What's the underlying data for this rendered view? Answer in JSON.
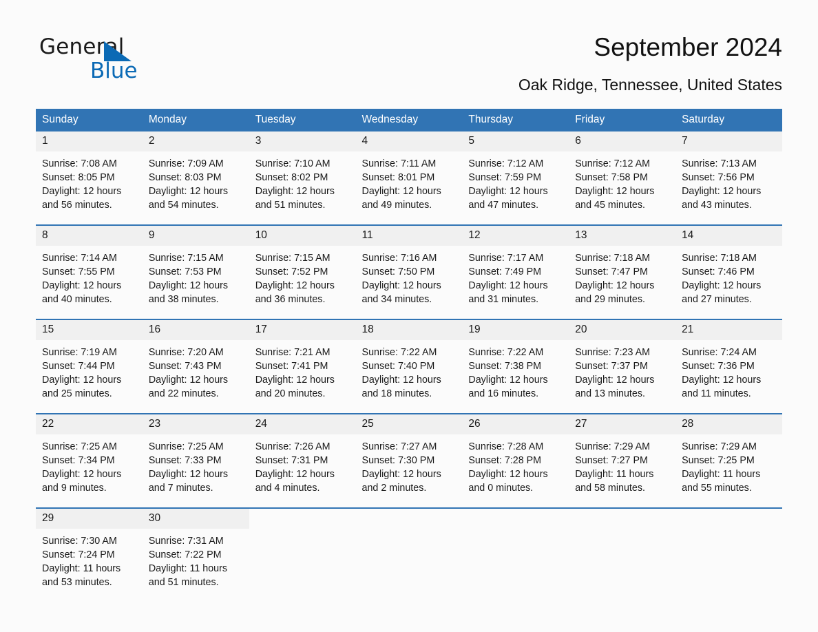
{
  "brand": {
    "name_part1": "General",
    "name_part2": "Blue",
    "triangle_color": "#0b6ab5"
  },
  "header": {
    "title": "September 2024",
    "location": "Oak Ridge, Tennessee, United States"
  },
  "theme": {
    "header_blue": "#3174b4",
    "date_band_gray": "#f0f0f0",
    "separator_blue": "#3174b4",
    "page_background": "#fbfbfb"
  },
  "weekdays": [
    "Sunday",
    "Monday",
    "Tuesday",
    "Wednesday",
    "Thursday",
    "Friday",
    "Saturday"
  ],
  "weeks": [
    [
      {
        "date": "1",
        "sunrise": "Sunrise: 7:08 AM",
        "sunset": "Sunset: 8:05 PM",
        "daylight_line1": "Daylight: 12 hours",
        "daylight_line2": "and 56 minutes."
      },
      {
        "date": "2",
        "sunrise": "Sunrise: 7:09 AM",
        "sunset": "Sunset: 8:03 PM",
        "daylight_line1": "Daylight: 12 hours",
        "daylight_line2": "and 54 minutes."
      },
      {
        "date": "3",
        "sunrise": "Sunrise: 7:10 AM",
        "sunset": "Sunset: 8:02 PM",
        "daylight_line1": "Daylight: 12 hours",
        "daylight_line2": "and 51 minutes."
      },
      {
        "date": "4",
        "sunrise": "Sunrise: 7:11 AM",
        "sunset": "Sunset: 8:01 PM",
        "daylight_line1": "Daylight: 12 hours",
        "daylight_line2": "and 49 minutes."
      },
      {
        "date": "5",
        "sunrise": "Sunrise: 7:12 AM",
        "sunset": "Sunset: 7:59 PM",
        "daylight_line1": "Daylight: 12 hours",
        "daylight_line2": "and 47 minutes."
      },
      {
        "date": "6",
        "sunrise": "Sunrise: 7:12 AM",
        "sunset": "Sunset: 7:58 PM",
        "daylight_line1": "Daylight: 12 hours",
        "daylight_line2": "and 45 minutes."
      },
      {
        "date": "7",
        "sunrise": "Sunrise: 7:13 AM",
        "sunset": "Sunset: 7:56 PM",
        "daylight_line1": "Daylight: 12 hours",
        "daylight_line2": "and 43 minutes."
      }
    ],
    [
      {
        "date": "8",
        "sunrise": "Sunrise: 7:14 AM",
        "sunset": "Sunset: 7:55 PM",
        "daylight_line1": "Daylight: 12 hours",
        "daylight_line2": "and 40 minutes."
      },
      {
        "date": "9",
        "sunrise": "Sunrise: 7:15 AM",
        "sunset": "Sunset: 7:53 PM",
        "daylight_line1": "Daylight: 12 hours",
        "daylight_line2": "and 38 minutes."
      },
      {
        "date": "10",
        "sunrise": "Sunrise: 7:15 AM",
        "sunset": "Sunset: 7:52 PM",
        "daylight_line1": "Daylight: 12 hours",
        "daylight_line2": "and 36 minutes."
      },
      {
        "date": "11",
        "sunrise": "Sunrise: 7:16 AM",
        "sunset": "Sunset: 7:50 PM",
        "daylight_line1": "Daylight: 12 hours",
        "daylight_line2": "and 34 minutes."
      },
      {
        "date": "12",
        "sunrise": "Sunrise: 7:17 AM",
        "sunset": "Sunset: 7:49 PM",
        "daylight_line1": "Daylight: 12 hours",
        "daylight_line2": "and 31 minutes."
      },
      {
        "date": "13",
        "sunrise": "Sunrise: 7:18 AM",
        "sunset": "Sunset: 7:47 PM",
        "daylight_line1": "Daylight: 12 hours",
        "daylight_line2": "and 29 minutes."
      },
      {
        "date": "14",
        "sunrise": "Sunrise: 7:18 AM",
        "sunset": "Sunset: 7:46 PM",
        "daylight_line1": "Daylight: 12 hours",
        "daylight_line2": "and 27 minutes."
      }
    ],
    [
      {
        "date": "15",
        "sunrise": "Sunrise: 7:19 AM",
        "sunset": "Sunset: 7:44 PM",
        "daylight_line1": "Daylight: 12 hours",
        "daylight_line2": "and 25 minutes."
      },
      {
        "date": "16",
        "sunrise": "Sunrise: 7:20 AM",
        "sunset": "Sunset: 7:43 PM",
        "daylight_line1": "Daylight: 12 hours",
        "daylight_line2": "and 22 minutes."
      },
      {
        "date": "17",
        "sunrise": "Sunrise: 7:21 AM",
        "sunset": "Sunset: 7:41 PM",
        "daylight_line1": "Daylight: 12 hours",
        "daylight_line2": "and 20 minutes."
      },
      {
        "date": "18",
        "sunrise": "Sunrise: 7:22 AM",
        "sunset": "Sunset: 7:40 PM",
        "daylight_line1": "Daylight: 12 hours",
        "daylight_line2": "and 18 minutes."
      },
      {
        "date": "19",
        "sunrise": "Sunrise: 7:22 AM",
        "sunset": "Sunset: 7:38 PM",
        "daylight_line1": "Daylight: 12 hours",
        "daylight_line2": "and 16 minutes."
      },
      {
        "date": "20",
        "sunrise": "Sunrise: 7:23 AM",
        "sunset": "Sunset: 7:37 PM",
        "daylight_line1": "Daylight: 12 hours",
        "daylight_line2": "and 13 minutes."
      },
      {
        "date": "21",
        "sunrise": "Sunrise: 7:24 AM",
        "sunset": "Sunset: 7:36 PM",
        "daylight_line1": "Daylight: 12 hours",
        "daylight_line2": "and 11 minutes."
      }
    ],
    [
      {
        "date": "22",
        "sunrise": "Sunrise: 7:25 AM",
        "sunset": "Sunset: 7:34 PM",
        "daylight_line1": "Daylight: 12 hours",
        "daylight_line2": "and 9 minutes."
      },
      {
        "date": "23",
        "sunrise": "Sunrise: 7:25 AM",
        "sunset": "Sunset: 7:33 PM",
        "daylight_line1": "Daylight: 12 hours",
        "daylight_line2": "and 7 minutes."
      },
      {
        "date": "24",
        "sunrise": "Sunrise: 7:26 AM",
        "sunset": "Sunset: 7:31 PM",
        "daylight_line1": "Daylight: 12 hours",
        "daylight_line2": "and 4 minutes."
      },
      {
        "date": "25",
        "sunrise": "Sunrise: 7:27 AM",
        "sunset": "Sunset: 7:30 PM",
        "daylight_line1": "Daylight: 12 hours",
        "daylight_line2": "and 2 minutes."
      },
      {
        "date": "26",
        "sunrise": "Sunrise: 7:28 AM",
        "sunset": "Sunset: 7:28 PM",
        "daylight_line1": "Daylight: 12 hours",
        "daylight_line2": "and 0 minutes."
      },
      {
        "date": "27",
        "sunrise": "Sunrise: 7:29 AM",
        "sunset": "Sunset: 7:27 PM",
        "daylight_line1": "Daylight: 11 hours",
        "daylight_line2": "and 58 minutes."
      },
      {
        "date": "28",
        "sunrise": "Sunrise: 7:29 AM",
        "sunset": "Sunset: 7:25 PM",
        "daylight_line1": "Daylight: 11 hours",
        "daylight_line2": "and 55 minutes."
      }
    ],
    [
      {
        "date": "29",
        "sunrise": "Sunrise: 7:30 AM",
        "sunset": "Sunset: 7:24 PM",
        "daylight_line1": "Daylight: 11 hours",
        "daylight_line2": "and 53 minutes."
      },
      {
        "date": "30",
        "sunrise": "Sunrise: 7:31 AM",
        "sunset": "Sunset: 7:22 PM",
        "daylight_line1": "Daylight: 11 hours",
        "daylight_line2": "and 51 minutes."
      },
      {
        "date": "",
        "sunrise": "",
        "sunset": "",
        "daylight_line1": "",
        "daylight_line2": ""
      },
      {
        "date": "",
        "sunrise": "",
        "sunset": "",
        "daylight_line1": "",
        "daylight_line2": ""
      },
      {
        "date": "",
        "sunrise": "",
        "sunset": "",
        "daylight_line1": "",
        "daylight_line2": ""
      },
      {
        "date": "",
        "sunrise": "",
        "sunset": "",
        "daylight_line1": "",
        "daylight_line2": ""
      },
      {
        "date": "",
        "sunrise": "",
        "sunset": "",
        "daylight_line1": "",
        "daylight_line2": ""
      }
    ]
  ]
}
